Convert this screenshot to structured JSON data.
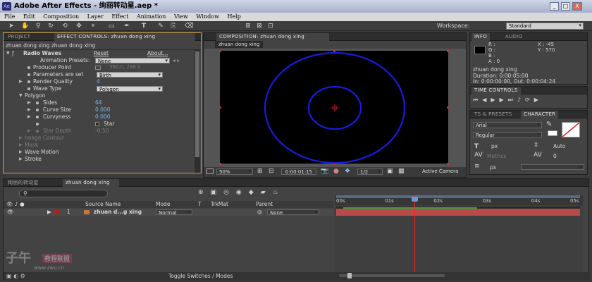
{
  "title_bar": {
    "title": "Adobe After Effects - 绚丽转动星.aep *",
    "icon": "ae-app-icon",
    "min_label": "_",
    "max_label": "□",
    "close_label": "X"
  },
  "menu": [
    "File",
    "Edit",
    "Composition",
    "Layer",
    "Effect",
    "Animation",
    "View",
    "Window",
    "Help"
  ],
  "workspace": {
    "label": "Workspace:",
    "value": "Standard"
  },
  "project_tabs": {
    "project": "PROJECT",
    "effect_controls": "EFFECT CONTROLS: zhuan dong xing"
  },
  "effect_controls": {
    "breadcrumb": "zhuan dong xing  zhuan dong xing",
    "effect_name": "Radio Waves",
    "reset": "Reset",
    "about": "About...",
    "presets_label": "Animation Presets:",
    "presets_value": "None",
    "producer_point": {
      "label": "Producer Point",
      "value": "360.0, 288.0"
    },
    "params_set": {
      "label": "Parameters are set",
      "value": "Birth"
    },
    "render_quality": {
      "label": "Render Quality",
      "value": "4"
    },
    "wave_type": {
      "label": "Wave Type",
      "value": "Polygon"
    },
    "polygon": "Polygon",
    "sides": {
      "label": "Sides",
      "value": "64"
    },
    "curve_size": {
      "label": "Curve Size",
      "value": "0.000"
    },
    "curvyness": {
      "label": "Curvyness",
      "value": "0.000"
    },
    "star": "Star",
    "star_depth": {
      "label": "Star Depth",
      "value": "-0.50"
    },
    "image_contour": "Image Contour",
    "mask": "Mask",
    "wave_motion": "Wave Motion",
    "stroke": "Stroke"
  },
  "composition": {
    "tab": "COMPOSITION: zhuan dong xing",
    "subtab": "zhuan dong xing",
    "zoom": "50%",
    "timecode": "0:00:01:15",
    "resolution": "1/2",
    "camera": "Active Camera"
  },
  "info": {
    "tab_info": "INFO",
    "tab_audio": "AUDIO",
    "r": "R :",
    "g": "G :",
    "b": "B :",
    "a": "A : 0",
    "x": "X : -45",
    "y": "Y : 570",
    "layer": "zhuan dong xing",
    "duration": "Duration: 0:00:05:00",
    "in_out": "In: 0:00:00:00, Out: 0:00:04:24"
  },
  "time_controls": {
    "tab": "TIME CONTROLS"
  },
  "character": {
    "tab_presets": "TS & PRESETS",
    "tab_character": "CHARACTER",
    "font": "Arial",
    "style": "Regular",
    "size": "px",
    "leading": "Auto",
    "metrics": "Metrics",
    "tracking": "0",
    "stroke_width": "px"
  },
  "timeline": {
    "tab1": "绚丽的转动星",
    "tab2": "zhuan dong xing",
    "search_placeholder": "",
    "col_source": "Source Name",
    "col_mode": "Mode",
    "col_t": "T",
    "col_trkmat": "TrkMat",
    "col_parent": "Parent",
    "layer_index": "1",
    "layer_name": "zhuan d...g xing",
    "layer_mode": "Normal",
    "layer_parent": "None",
    "ruler": [
      "00s",
      "01s",
      "02s",
      "03s",
      "04s",
      "05s"
    ],
    "toggle": "Toggle Switches / Modes",
    "playhead_fraction": 0.32
  },
  "watermark": {
    "text1": "子午",
    "text2": "教程联盟",
    "text3": "www.zwu.cn"
  },
  "colors": {
    "wave": "#1212d6",
    "layer_bar": "#b84a4a",
    "label_red": "#b02020",
    "playhead": "#ff2020"
  }
}
